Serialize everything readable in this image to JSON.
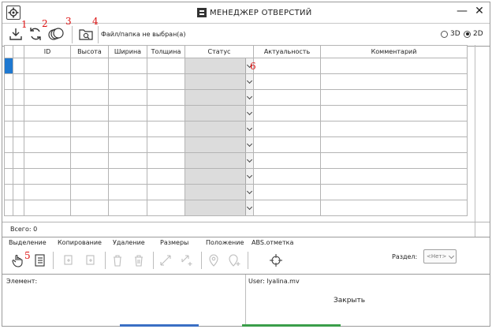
{
  "window": {
    "title": "МЕНЕДЖЕР ОТВЕРСТИЙ",
    "minimize_label": "—",
    "close_label": "✕"
  },
  "toolbar": {
    "file_status": "Файл/папка не выбран(а)",
    "markers": [
      "1",
      "2",
      "3",
      "4"
    ],
    "view_3d": "3D",
    "view_2d": "2D",
    "selected_view": "2D"
  },
  "grid": {
    "columns": [
      "",
      "",
      "ID",
      "Высота",
      "Ширина",
      "Толщина",
      "Статус",
      "Актуальность",
      "Комментарий"
    ],
    "row_count": 10,
    "status_marker": "6"
  },
  "total": {
    "label": "Всего: 0"
  },
  "ribbon": {
    "groups": {
      "selection": "Выделение",
      "copy": "Копирование",
      "delete": "Удаление",
      "sizes": "Размеры",
      "position": "Положение",
      "abs": "ABS.отметка"
    },
    "selection_marker": "5",
    "section_label": "Раздел:",
    "section_value": "<Нет>"
  },
  "info": {
    "element_label": "Элемент:",
    "user_label": "User: lyalina.mv",
    "close_label": "Закрыть"
  },
  "icons": {
    "settings": "gear-icon",
    "import": "download-icon",
    "refresh": "refresh-icon",
    "layers": "layers-icon",
    "folder": "folder-search-icon"
  },
  "colors": {
    "accent": "#1e78d0",
    "marker": "#dd1111",
    "status_bg": "#dcdcdc"
  }
}
